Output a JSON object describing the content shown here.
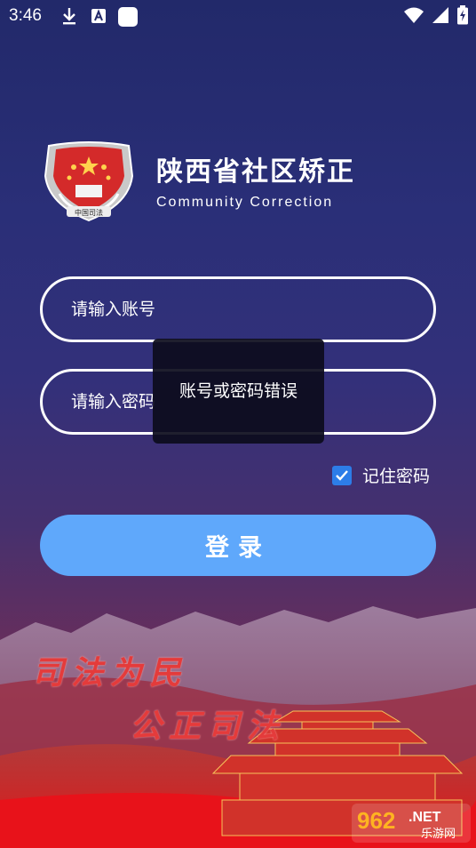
{
  "status_bar": {
    "time": "3:46",
    "icons_left": [
      "download-icon",
      "a-badge-icon",
      "square-app-icon"
    ],
    "icons_right": [
      "wifi-icon",
      "signal-icon",
      "battery-charging-icon"
    ]
  },
  "brand": {
    "title_cn": "陕西省社区矫正",
    "title_en": "Community Correction",
    "emblem_text": "中国司法"
  },
  "form": {
    "account_placeholder": "请输入账号",
    "password_placeholder": "请输入密码",
    "remember_label": "记住密码",
    "remember_checked": true,
    "login_label": "登录"
  },
  "toast": {
    "message": "账号或密码错误"
  },
  "banner": {
    "slogan_1": "司法为民",
    "slogan_2": "公正司法"
  },
  "watermark": {
    "number": "962",
    "suffix": ".NET",
    "site_name": "乐游网"
  },
  "colors": {
    "button": "#5fa8fb",
    "checkbox": "#2d7de8",
    "slogan": "#e43b3b"
  }
}
